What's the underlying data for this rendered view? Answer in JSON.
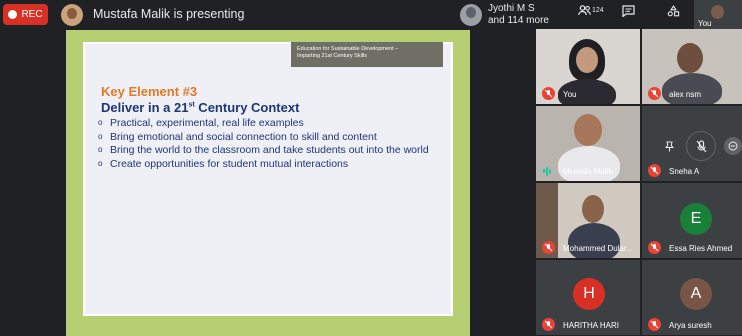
{
  "top_bar": {
    "rec_label": "REC",
    "presenting": "Mustafa Malik is presenting",
    "viewers_line1": "Jyothi M S",
    "viewers_line2": "and 114 more",
    "people_count": "124",
    "you_label": "You"
  },
  "slide": {
    "header_line1": "Education for Sustainable Development –",
    "header_line2": "Imparting 21st Century Skills",
    "key_element": "Key Element #3",
    "deliver_prefix": "Deliver in a 21",
    "deliver_sup": "st",
    "deliver_suffix": " Century Context",
    "bullets": [
      "Practical, experimental, real life examples",
      "Bring emotional and social connection to skill and content",
      "Bring the world to the classroom and take students out into the world",
      "Create opportunities for student mutual interactions"
    ]
  },
  "participants": [
    {
      "name": "You",
      "muted": true
    },
    {
      "name": "alex nsm",
      "muted": true
    },
    {
      "name": "Mustafa Malik",
      "muted": false
    },
    {
      "name": "Sneha A",
      "muted": true
    },
    {
      "name": "Mohammed Dular...",
      "muted": true
    },
    {
      "name": "Essa Ries Ahmed",
      "muted": true,
      "initial": "E",
      "color": "#188038"
    },
    {
      "name": "HARITHA HARI",
      "muted": true,
      "initial": "H",
      "color": "#d93025"
    },
    {
      "name": "Arya suresh",
      "muted": true,
      "initial": "A",
      "color": "#795548"
    }
  ],
  "colors": {
    "rec": "#d93025",
    "slide_frame": "#b5cf72",
    "accent_orange": "#e07a24",
    "text_navy": "#1f3575",
    "speaking": "#1ec9a5",
    "muted": "#ea4335"
  }
}
